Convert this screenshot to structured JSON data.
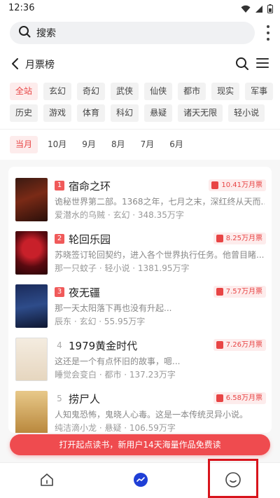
{
  "status": {
    "time": "12:36",
    "icons": [
      "wifi-icon",
      "signal-icon",
      "battery-icon"
    ]
  },
  "search": {
    "label": "搜索",
    "icon": "search-icon"
  },
  "header": {
    "title": "月票榜"
  },
  "categories": {
    "row1": [
      "全站",
      "玄幻",
      "奇幻",
      "武侠",
      "仙侠",
      "都市",
      "现实",
      "军事"
    ],
    "row2": [
      "历史",
      "游戏",
      "体育",
      "科幻",
      "悬疑",
      "诸天无限",
      "轻小说"
    ],
    "selected": "全站"
  },
  "months": {
    "items": [
      "当月",
      "10月",
      "9月",
      "8月",
      "7月",
      "6月"
    ],
    "selected": "当月"
  },
  "books": [
    {
      "rank": "1",
      "title": "宿命之环",
      "tickets": "10.41万月票",
      "desc": "诡秘世界第二部。1368之年，七月之末，深红终从天而...",
      "meta": "爱潜水的乌贼 · 玄幻 · 348.35万字"
    },
    {
      "rank": "2",
      "title": "轮回乐园",
      "tickets": "8.25万月票",
      "desc": "苏晓签订轮回契约，进入各个世界执行任务。他曾目睹...",
      "meta": "那一只蚊子 · 轻小说 · 1381.95万字"
    },
    {
      "rank": "3",
      "title": "夜无疆",
      "tickets": "7.57万月票",
      "desc": "那一天太阳落下再也没有升起...",
      "meta": "辰东 · 玄幻 · 55.95万字"
    },
    {
      "rank": "4",
      "title": "1979黄金时代",
      "tickets": "7.26万月票",
      "desc": "这还是一个有点怀旧的故事，嗯...",
      "meta": "睡觉会变白 · 都市 · 137.23万字"
    },
    {
      "rank": "5",
      "title": "捞尸人",
      "tickets": "6.58万月票",
      "desc": "人知鬼恐怖，鬼晓人心毒。这是一本传统灵异小说。",
      "meta": "纯洁滴小龙 · 悬疑 · 106.59万字"
    }
  ],
  "promo": {
    "text": "打开起点读书，新用户14天海量作品免费读"
  },
  "tabbar": {
    "items": [
      "home-icon",
      "feed-icon",
      "profile-icon"
    ]
  },
  "colors": {
    "accent": "#e84545",
    "promo": "#ef4b4f",
    "highlight": "#d8141c"
  }
}
